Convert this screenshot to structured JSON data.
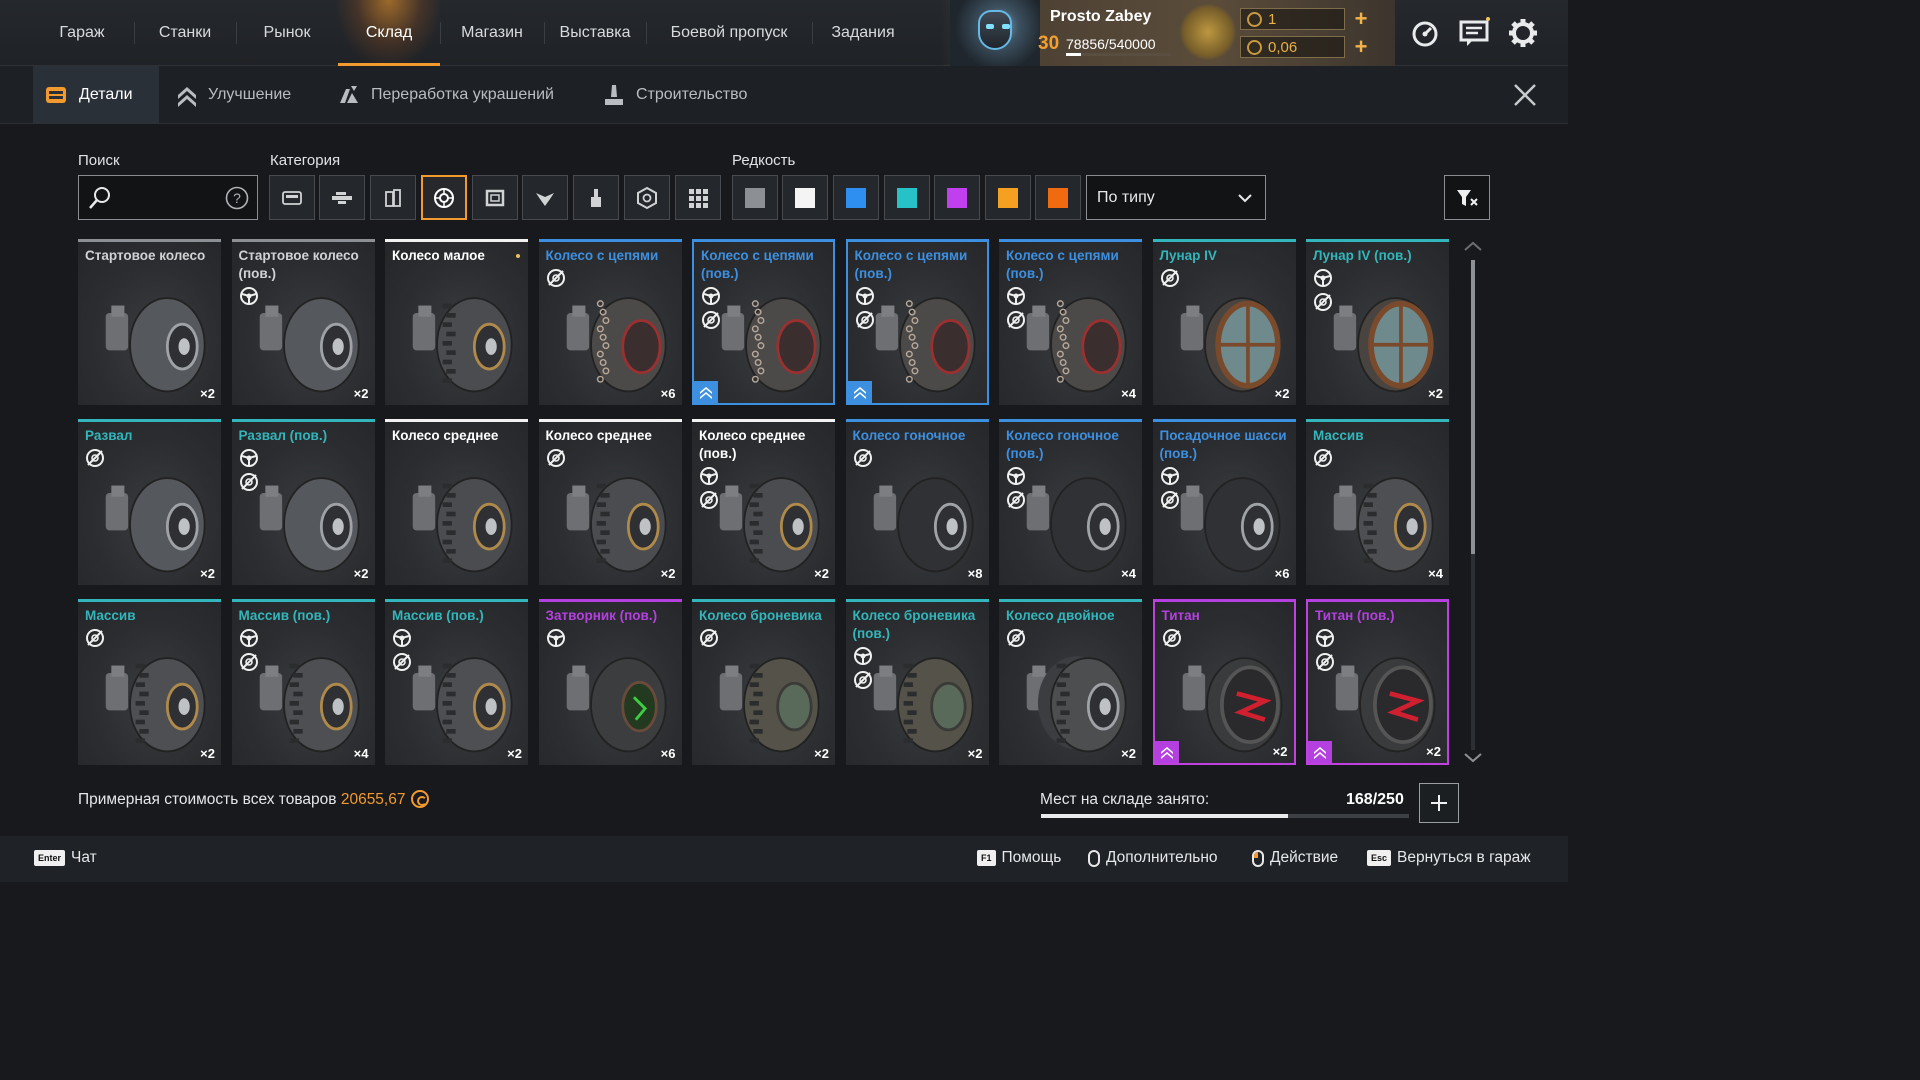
{
  "nav": {
    "items": [
      "Гараж",
      "Станки",
      "Рынок",
      "Склад",
      "Магазин",
      "Выставка",
      "Боевой пропуск",
      "Задания"
    ],
    "active_index": 3
  },
  "profile": {
    "name": "Prosto Zabey",
    "level": "30",
    "xp": "78856/540000",
    "xp_fraction": 0.146,
    "coins": "1",
    "crystals": "0,06"
  },
  "icons": {
    "speed": "speedometer-icon",
    "messages": "messages-icon",
    "settings": "gear-icon"
  },
  "subtabs": [
    {
      "label": "Детали",
      "icon": "parts-icon",
      "active": true
    },
    {
      "label": "Улучшение",
      "icon": "upgrade-icon",
      "active": false
    },
    {
      "label": "Переработка украшений",
      "icon": "recycle-icon",
      "active": false
    },
    {
      "label": "Строительство",
      "icon": "build-icon",
      "active": false
    }
  ],
  "filters": {
    "search_label": "Поиск",
    "category_label": "Категория",
    "rarity_label": "Редкость",
    "categories": [
      "cabin-icon",
      "weapon-icon",
      "module-icon",
      "wheel-icon",
      "frame-icon",
      "decor-icon",
      "paint-icon",
      "resource-icon",
      "grid-icon"
    ],
    "active_category": 3,
    "rarity_colors": [
      "#8c8f93",
      "#f4f4f4",
      "#2f8ff0",
      "#27c1c8",
      "#c040f0",
      "#f5a020",
      "#f06a10"
    ],
    "sort_value": "По типу"
  },
  "rarity": {
    "common": "#8c8f93",
    "white": "#f2f2f2",
    "blue": "#3d8fe0",
    "cyan": "#33b6bb",
    "purple": "#b440e0"
  },
  "items": [
    {
      "name": "Стартовое колесо",
      "rarity": "common",
      "count": "×2",
      "icons": [],
      "wheel": "plain"
    },
    {
      "name": "Стартовое колесо (пов.)",
      "rarity": "common",
      "count": "×2",
      "icons": [
        "steer"
      ],
      "wheel": "plain"
    },
    {
      "name": "Колесо малое",
      "rarity": "white",
      "count": "",
      "icons": [],
      "wheel": "offroad",
      "new": true
    },
    {
      "name": "Колесо с цепями",
      "rarity": "blue",
      "count": "×6",
      "icons": [
        "nodrive"
      ],
      "wheel": "chain"
    },
    {
      "name": "Колесо с цепями (пов.)",
      "rarity": "blue",
      "count": "",
      "icons": [
        "steer",
        "nodrive"
      ],
      "wheel": "chain",
      "selected": true,
      "badge": true
    },
    {
      "name": "Колесо с цепями (пов.)",
      "rarity": "blue",
      "count": "",
      "icons": [
        "steer",
        "nodrive"
      ],
      "wheel": "chain",
      "selected": true,
      "badge": true
    },
    {
      "name": "Колесо с цепями (пов.)",
      "rarity": "blue",
      "count": "×4",
      "icons": [
        "steer",
        "nodrive"
      ],
      "wheel": "chain"
    },
    {
      "name": "Лунар IV",
      "rarity": "cyan",
      "count": "×2",
      "icons": [
        "nodrive"
      ],
      "wheel": "lunar"
    },
    {
      "name": "Лунар IV (пов.)",
      "rarity": "cyan",
      "count": "×2",
      "icons": [
        "steer",
        "nodrive"
      ],
      "wheel": "lunar"
    },
    {
      "name": "Развал",
      "rarity": "cyan",
      "count": "×2",
      "icons": [
        "nodrive"
      ],
      "wheel": "plain"
    },
    {
      "name": "Развал (пов.)",
      "rarity": "cyan",
      "count": "×2",
      "icons": [
        "steer",
        "nodrive"
      ],
      "wheel": "plain"
    },
    {
      "name": "Колесо среднее",
      "rarity": "white",
      "count": "",
      "icons": [],
      "wheel": "offroad"
    },
    {
      "name": "Колесо среднее",
      "rarity": "white",
      "count": "×2",
      "icons": [
        "nodrive"
      ],
      "wheel": "offroad"
    },
    {
      "name": "Колесо среднее (пов.)",
      "rarity": "white",
      "count": "×2",
      "icons": [
        "steer",
        "nodrive"
      ],
      "wheel": "offroad"
    },
    {
      "name": "Колесо гоночное",
      "rarity": "blue",
      "count": "×8",
      "icons": [
        "nodrive"
      ],
      "wheel": "race"
    },
    {
      "name": "Колесо гоночное (пов.)",
      "rarity": "blue",
      "count": "×4",
      "icons": [
        "steer",
        "nodrive"
      ],
      "wheel": "race"
    },
    {
      "name": "Посадочное шасси (пов.)",
      "rarity": "blue",
      "count": "×6",
      "icons": [
        "steer",
        "nodrive"
      ],
      "wheel": "race"
    },
    {
      "name": "Массив",
      "rarity": "cyan",
      "count": "×4",
      "icons": [
        "nodrive"
      ],
      "wheel": "massive"
    },
    {
      "name": "Массив",
      "rarity": "cyan",
      "count": "×2",
      "icons": [
        "nodrive"
      ],
      "wheel": "massive"
    },
    {
      "name": "Массив (пов.)",
      "rarity": "cyan",
      "count": "×4",
      "icons": [
        "steer",
        "nodrive"
      ],
      "wheel": "massive"
    },
    {
      "name": "Массив (пов.)",
      "rarity": "cyan",
      "count": "×2",
      "icons": [
        "steer",
        "nodrive"
      ],
      "wheel": "massive"
    },
    {
      "name": "Затворник (пов.)",
      "rarity": "purple",
      "count": "×6",
      "icons": [
        "steer"
      ],
      "wheel": "hermit"
    },
    {
      "name": "Колесо броневика",
      "rarity": "cyan",
      "count": "×2",
      "icons": [
        "nodrive"
      ],
      "wheel": "armored"
    },
    {
      "name": "Колесо броневика (пов.)",
      "rarity": "cyan",
      "count": "×2",
      "icons": [
        "steer",
        "nodrive"
      ],
      "wheel": "armored"
    },
    {
      "name": "Колесо двойное",
      "rarity": "cyan",
      "count": "×2",
      "icons": [
        "nodrive"
      ],
      "wheel": "double"
    },
    {
      "name": "Титан",
      "rarity": "purple",
      "count": "×2",
      "icons": [
        "nodrive"
      ],
      "wheel": "titan",
      "selected": true,
      "badge": true
    },
    {
      "name": "Титан (пов.)",
      "rarity": "purple",
      "count": "×2",
      "icons": [
        "steer",
        "nodrive"
      ],
      "wheel": "titan",
      "selected": true,
      "badge": true
    }
  ],
  "scroll_fraction": 0.6,
  "footer": {
    "total_label": "Примерная стоимость всех товаров",
    "total_value": "20655,67",
    "storage_label": "Мест на складе занято:",
    "storage_value": "168/250",
    "storage_fraction": 0.672
  },
  "hints": [
    {
      "key": "Enter",
      "label": "Чат"
    },
    {
      "key": "F1",
      "label": "Помощь"
    },
    {
      "key": "mouse-middle",
      "label": "Дополнительно"
    },
    {
      "key": "mouse-left",
      "label": "Действие"
    },
    {
      "key": "Esc",
      "label": "Вернуться в гараж"
    }
  ]
}
